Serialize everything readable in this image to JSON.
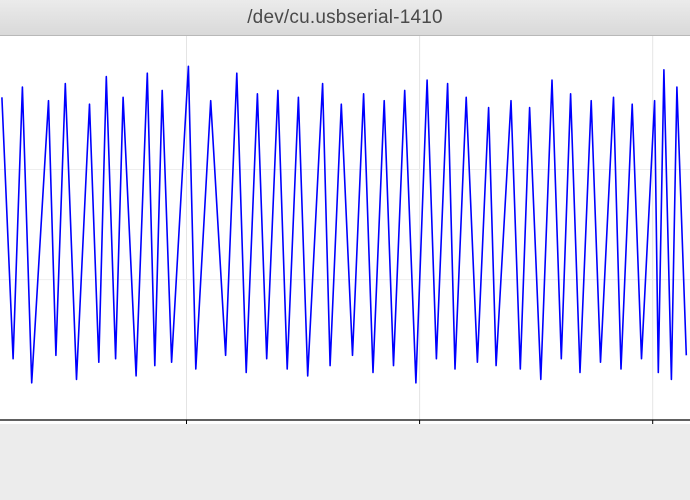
{
  "window": {
    "title": "/dev/cu.usbserial-1410"
  },
  "chart_data": {
    "type": "line",
    "title": "",
    "xlabel": "",
    "ylabel": "",
    "xlim": [
      3387,
      3757
    ],
    "ylim": [
      0,
      100
    ],
    "grid": true,
    "x_ticks": [
      3487,
      3612,
      3737
    ],
    "series": [
      {
        "color": "#0000ff",
        "peaks": [
          [
            3388,
            88
          ],
          [
            3399,
            91
          ],
          [
            3413,
            87
          ],
          [
            3422,
            92
          ],
          [
            3435,
            86
          ],
          [
            3444,
            94
          ],
          [
            3453,
            88
          ],
          [
            3466,
            95
          ],
          [
            3474,
            90
          ],
          [
            3488,
            97
          ],
          [
            3500,
            87
          ],
          [
            3514,
            95
          ],
          [
            3525,
            89
          ],
          [
            3536,
            90
          ],
          [
            3547,
            88
          ],
          [
            3560,
            92
          ],
          [
            3570,
            86
          ],
          [
            3582,
            89
          ],
          [
            3593,
            87
          ],
          [
            3604,
            90
          ],
          [
            3616,
            93
          ],
          [
            3627,
            92
          ],
          [
            3637,
            88
          ],
          [
            3649,
            85
          ],
          [
            3661,
            87
          ],
          [
            3671,
            85
          ],
          [
            3683,
            93
          ],
          [
            3693,
            89
          ],
          [
            3704,
            87
          ],
          [
            3716,
            88
          ],
          [
            3726,
            86
          ],
          [
            3738,
            87
          ],
          [
            3743,
            96
          ],
          [
            3750,
            91
          ]
        ],
        "troughs": [
          [
            3394,
            12
          ],
          [
            3404,
            5
          ],
          [
            3417,
            13
          ],
          [
            3428,
            6
          ],
          [
            3440,
            11
          ],
          [
            3449,
            12
          ],
          [
            3460,
            7
          ],
          [
            3470,
            10
          ],
          [
            3479,
            11
          ],
          [
            3492,
            9
          ],
          [
            3508,
            13
          ],
          [
            3519,
            8
          ],
          [
            3530,
            12
          ],
          [
            3541,
            9
          ],
          [
            3552,
            7
          ],
          [
            3564,
            10
          ],
          [
            3576,
            13
          ],
          [
            3587,
            8
          ],
          [
            3598,
            10
          ],
          [
            3610,
            5
          ],
          [
            3621,
            12
          ],
          [
            3631,
            9
          ],
          [
            3643,
            11
          ],
          [
            3653,
            10
          ],
          [
            3666,
            9
          ],
          [
            3677,
            6
          ],
          [
            3688,
            12
          ],
          [
            3698,
            8
          ],
          [
            3709,
            11
          ],
          [
            3720,
            9
          ],
          [
            3731,
            12
          ],
          [
            3740,
            8
          ],
          [
            3747,
            6
          ],
          [
            3755,
            13
          ]
        ]
      }
    ]
  }
}
